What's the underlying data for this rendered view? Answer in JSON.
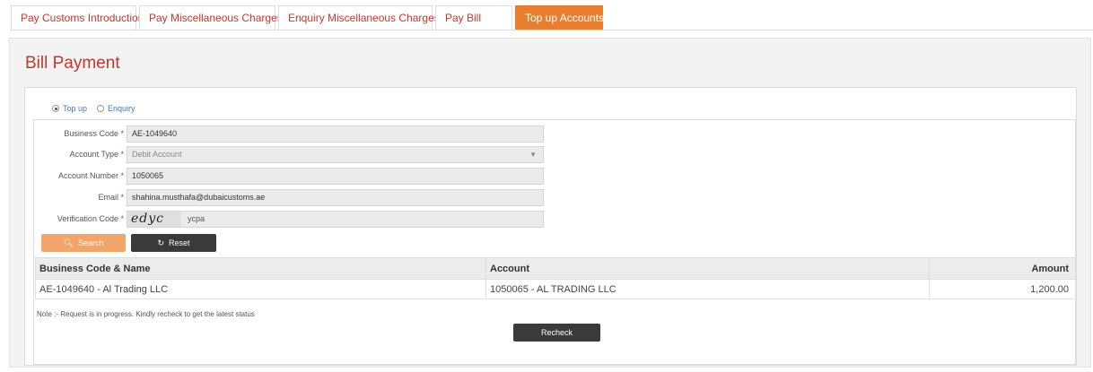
{
  "tabs": [
    {
      "label": "Pay Customs Introduction",
      "active": false
    },
    {
      "label": "Pay Miscellaneous Charges",
      "active": false
    },
    {
      "label": "Enquiry Miscellaneous Charges",
      "active": false
    },
    {
      "label": "Pay Bill",
      "active": false
    },
    {
      "label": "Top up Accounts",
      "active": true
    }
  ],
  "page": {
    "title": "Bill Payment"
  },
  "mode": {
    "options": [
      {
        "label": "Top up",
        "checked": true
      },
      {
        "label": "Enquiry",
        "checked": false
      }
    ]
  },
  "form": {
    "business_code": {
      "label": "Business Code",
      "value": "AE-1049640"
    },
    "account_type": {
      "label": "Account Type",
      "value": "Debit Account"
    },
    "account_number": {
      "label": "Account Number",
      "value": "1050065"
    },
    "email": {
      "label": "Email",
      "value": "shahina.musthafa@dubaicustoms.ae"
    },
    "verification": {
      "label": "Verification Code",
      "captcha_text": "edyc",
      "value": "ycpa"
    },
    "required_mark": "*"
  },
  "buttons": {
    "search": "Search",
    "reset": "Reset",
    "recheck": "Recheck"
  },
  "table": {
    "columns": [
      "Business Code & Name",
      "Account",
      "Amount"
    ],
    "rows": [
      [
        "AE-1049640 - Al Trading LLC",
        "1050065 - AL TRADING LLC",
        "1,200.00"
      ]
    ]
  },
  "note": "Note :- Request is in progress. Kindly recheck to get the latest status",
  "colors": {
    "accent": "#e87e2f",
    "title": "#c0392b",
    "dark_button": "#3a3a3a"
  }
}
